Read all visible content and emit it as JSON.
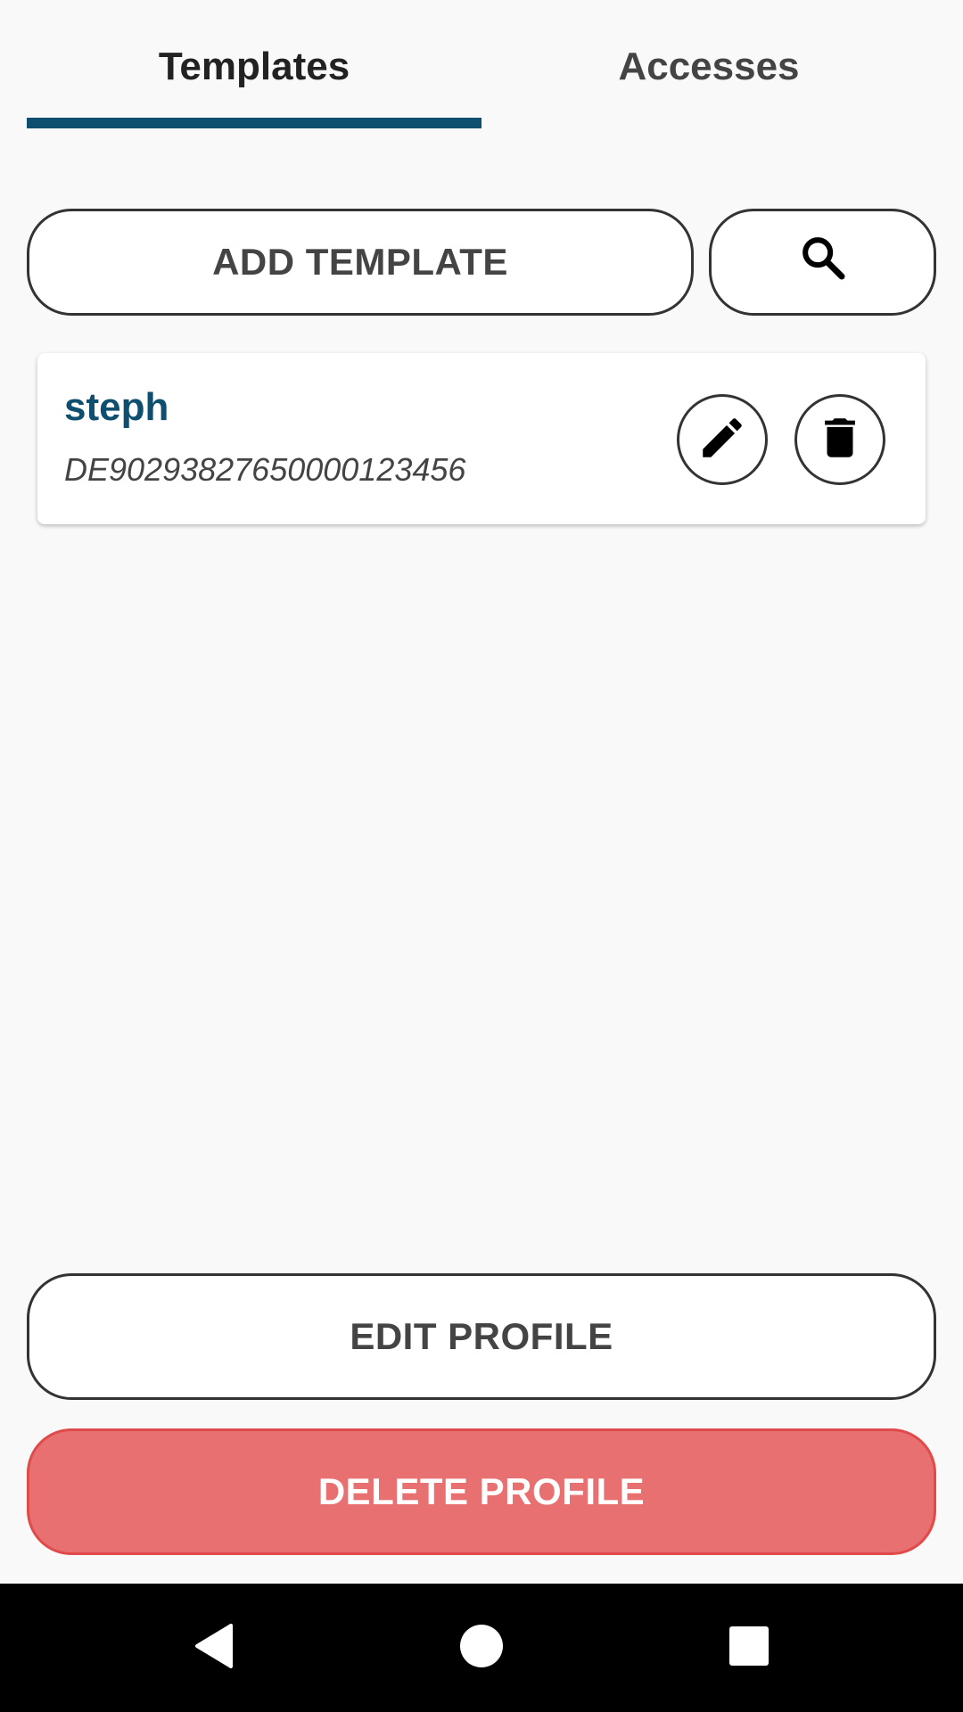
{
  "tabs": [
    {
      "label": "Templates",
      "active": true
    },
    {
      "label": "Accesses",
      "active": false
    }
  ],
  "toolbar": {
    "add_template_label": "ADD TEMPLATE",
    "search_icon": "search-icon"
  },
  "templates": [
    {
      "name": "steph",
      "iban": "DE90293827650000123456",
      "actions": [
        "pencil-icon",
        "trash-icon"
      ]
    }
  ],
  "footer": {
    "edit_profile_label": "EDIT PROFILE",
    "delete_profile_label": "DELETE PROFILE"
  },
  "nav_bar": [
    "back-icon",
    "home-icon",
    "recents-icon"
  ],
  "colors": {
    "accent": "#0e4e6e",
    "danger": "#e87070",
    "background": "#f9f9f9"
  }
}
